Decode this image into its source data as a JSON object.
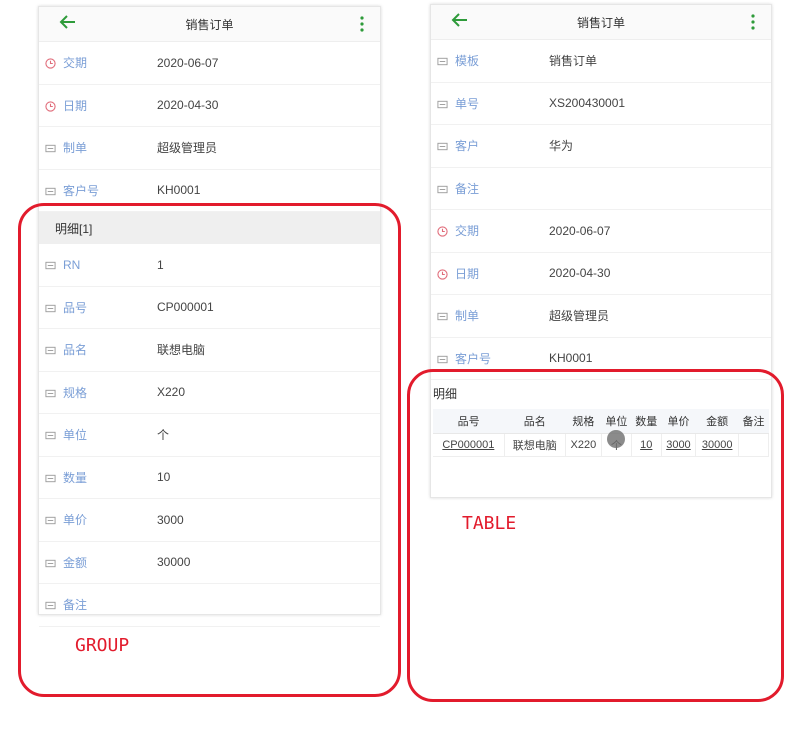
{
  "left": {
    "title": "销售订单",
    "fields": [
      {
        "label": "交期",
        "value": "2020-06-07",
        "icon": "clock-icon"
      },
      {
        "label": "日期",
        "value": "2020-04-30",
        "icon": "clock-icon"
      },
      {
        "label": "制单",
        "value": "超级管理员",
        "icon": "field-icon"
      },
      {
        "label": "客户号",
        "value": "KH0001",
        "icon": "field-icon"
      }
    ],
    "group_title": "明细[1]",
    "group_fields": [
      {
        "label": "RN",
        "value": "1",
        "icon": "field-icon"
      },
      {
        "label": "品号",
        "value": "CP000001",
        "icon": "field-icon"
      },
      {
        "label": "品名",
        "value": "联想电脑",
        "icon": "field-icon"
      },
      {
        "label": "规格",
        "value": "X220",
        "icon": "field-icon"
      },
      {
        "label": "单位",
        "value": "个",
        "icon": "field-icon"
      },
      {
        "label": "数量",
        "value": "10",
        "icon": "field-icon"
      },
      {
        "label": "单价",
        "value": "3000",
        "icon": "field-icon"
      },
      {
        "label": "金额",
        "value": "30000",
        "icon": "field-icon"
      },
      {
        "label": "备注",
        "value": "",
        "icon": "field-icon"
      }
    ]
  },
  "right": {
    "title": "销售订单",
    "fields": [
      {
        "label": "模板",
        "value": "销售订单",
        "icon": "field-icon"
      },
      {
        "label": "单号",
        "value": "XS200430001",
        "icon": "field-icon"
      },
      {
        "label": "客户",
        "value": "华为",
        "icon": "field-icon"
      },
      {
        "label": "备注",
        "value": "",
        "icon": "field-icon"
      },
      {
        "label": "交期",
        "value": "2020-06-07",
        "icon": "clock-icon"
      },
      {
        "label": "日期",
        "value": "2020-04-30",
        "icon": "clock-icon"
      },
      {
        "label": "制单",
        "value": "超级管理员",
        "icon": "field-icon"
      },
      {
        "label": "客户号",
        "value": "KH0001",
        "icon": "field-icon"
      }
    ],
    "table_title": "明细",
    "table_columns": [
      "品号",
      "品名",
      "规格",
      "单位",
      "数量",
      "单价",
      "金额",
      "备注"
    ],
    "table_rows": [
      [
        "CP000001",
        "联想电脑",
        "X220",
        "个",
        "10",
        "3000",
        "30000",
        ""
      ]
    ]
  },
  "annotations": {
    "group_label": "GROUP",
    "table_label": "TABLE"
  },
  "colors": {
    "accent_green": "#2e9b3a",
    "label_blue": "#7a9ed6",
    "clock_red": "#e06c7a",
    "highlight_red": "#e21b2c"
  }
}
